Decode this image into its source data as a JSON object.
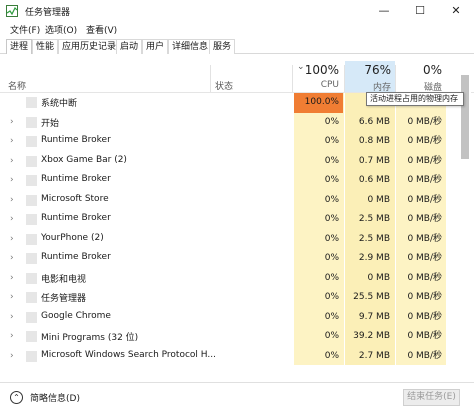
{
  "window": {
    "title": "任务管理器",
    "controls": {
      "minimize": "—",
      "maximize": "☐",
      "close": "✕"
    }
  },
  "menu": [
    "文件(F)",
    "选项(O)",
    "查看(V)"
  ],
  "tabs": [
    {
      "label": "进程",
      "active": true
    },
    {
      "label": "性能",
      "active": false
    },
    {
      "label": "应用历史记录",
      "active": false
    },
    {
      "label": "启动",
      "active": false
    },
    {
      "label": "用户",
      "active": false
    },
    {
      "label": "详细信息",
      "active": false
    },
    {
      "label": "服务",
      "active": false
    }
  ],
  "columns": {
    "name": "名称",
    "status": "状态",
    "cpu": {
      "percent": "100%",
      "label": "CPU",
      "sort_arrow": "⌄"
    },
    "memory": {
      "percent": "76%",
      "label": "内存"
    },
    "disk": {
      "percent": "0%",
      "label": "磁盘"
    }
  },
  "tooltip": "活动进程占用的物理内存",
  "processes": [
    {
      "name": "系统中断",
      "expandable": false,
      "cpu": "100.0%",
      "memory": "",
      "disk": "",
      "cpu_hot": true
    },
    {
      "name": "开始",
      "expandable": true,
      "cpu": "0%",
      "memory": "6.6 MB",
      "disk": "0 MB/秒"
    },
    {
      "name": "Runtime Broker",
      "expandable": true,
      "cpu": "0%",
      "memory": "0.8 MB",
      "disk": "0 MB/秒"
    },
    {
      "name": "Xbox Game Bar (2)",
      "expandable": true,
      "cpu": "0%",
      "memory": "0.7 MB",
      "disk": "0 MB/秒"
    },
    {
      "name": "Runtime Broker",
      "expandable": true,
      "cpu": "0%",
      "memory": "0.6 MB",
      "disk": "0 MB/秒"
    },
    {
      "name": "Microsoft Store",
      "expandable": true,
      "cpu": "0%",
      "memory": "0 MB",
      "disk": "0 MB/秒"
    },
    {
      "name": "Runtime Broker",
      "expandable": true,
      "cpu": "0%",
      "memory": "2.5 MB",
      "disk": "0 MB/秒"
    },
    {
      "name": "YourPhone (2)",
      "expandable": true,
      "cpu": "0%",
      "memory": "2.5 MB",
      "disk": "0 MB/秒"
    },
    {
      "name": "Runtime Broker",
      "expandable": true,
      "cpu": "0%",
      "memory": "2.9 MB",
      "disk": "0 MB/秒"
    },
    {
      "name": "电影和电视",
      "expandable": true,
      "cpu": "0%",
      "memory": "0 MB",
      "disk": "0 MB/秒"
    },
    {
      "name": "任务管理器",
      "expandable": true,
      "cpu": "0%",
      "memory": "25.5 MB",
      "disk": "0 MB/秒"
    },
    {
      "name": "Google Chrome",
      "expandable": true,
      "cpu": "0%",
      "memory": "9.7 MB",
      "disk": "0 MB/秒"
    },
    {
      "name": "Mini Programs (32 位)",
      "expandable": true,
      "cpu": "0%",
      "memory": "39.2 MB",
      "disk": "0 MB/秒"
    },
    {
      "name": "Microsoft Windows Search Protocol H...",
      "expandable": true,
      "cpu": "0%",
      "memory": "2.7 MB",
      "disk": "0 MB/秒"
    }
  ],
  "footer": {
    "fewer_details": "简略信息(D)",
    "end_task": "结束任务(E)"
  },
  "colors": {
    "cpu_column": "#fdf3c4",
    "cpu_hot": "#f07d33",
    "memory_column": "#fbefb7",
    "memory_header": "#d6e9f8"
  }
}
